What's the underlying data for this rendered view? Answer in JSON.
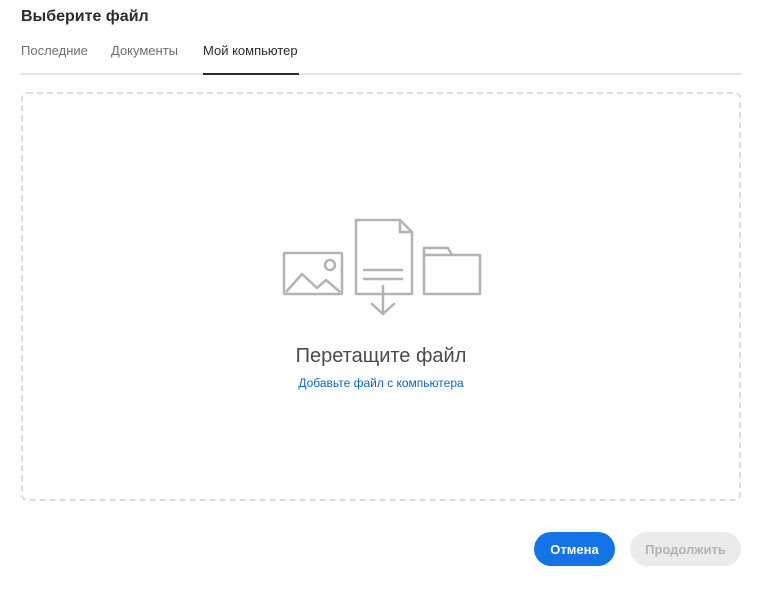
{
  "dialog": {
    "title": "Выберите файл"
  },
  "tabs": [
    {
      "label": "Последние",
      "active": false
    },
    {
      "label": "Документы",
      "active": false
    },
    {
      "label": "Мой компьютер",
      "active": true
    }
  ],
  "dropzone": {
    "title": "Перетащите файл",
    "link": "Добавьте файл с компьютера",
    "icons": [
      "image-icon",
      "file-download-icon",
      "folder-icon"
    ]
  },
  "footer": {
    "cancel_label": "Отмена",
    "continue_label": "Продолжить"
  },
  "colors": {
    "accent": "#1473e6",
    "link": "#0d66d0",
    "icon_stroke": "#b3b3b3",
    "disabled_bg": "#ebebeb",
    "disabled_text": "#b3b3b3"
  }
}
